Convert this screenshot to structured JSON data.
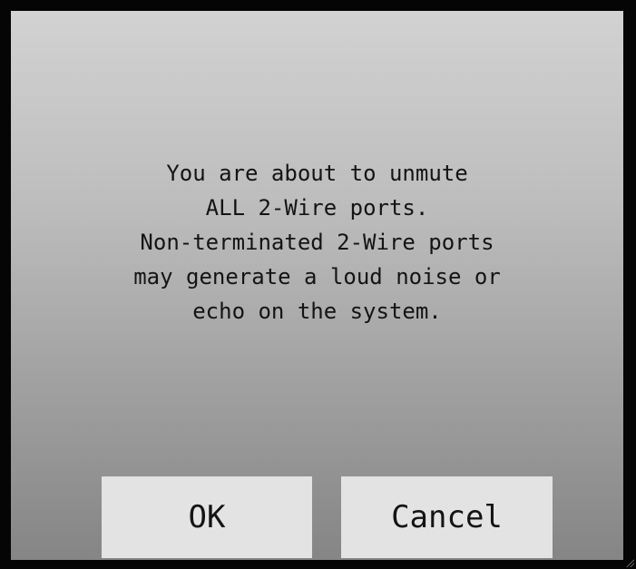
{
  "dialog": {
    "message_lines": [
      "You are about to unmute",
      "ALL 2-Wire ports.",
      "Non-terminated 2-Wire ports",
      "may generate a loud noise or",
      "echo on the system."
    ],
    "ok_label": "OK",
    "cancel_label": "Cancel"
  },
  "colors": {
    "frame": "#050505",
    "dialog_top": "#d2d2d2",
    "dialog_bottom": "#858585",
    "button_bg": "#e3e3e3",
    "text": "#141414"
  }
}
